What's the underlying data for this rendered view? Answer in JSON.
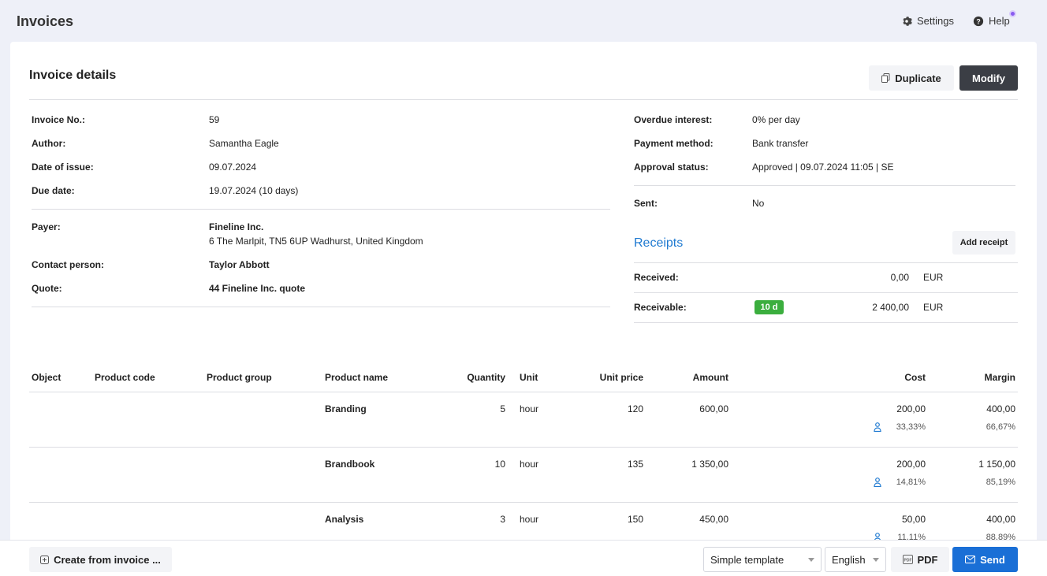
{
  "header": {
    "title": "Invoices",
    "settings_label": "Settings",
    "help_label": "Help"
  },
  "card": {
    "title": "Invoice details",
    "duplicate_label": "Duplicate",
    "modify_label": "Modify"
  },
  "details_left": {
    "invoice_no_label": "Invoice No.:",
    "invoice_no": "59",
    "author_label": "Author:",
    "author": "Samantha Eagle",
    "date_issue_label": "Date of issue:",
    "date_issue": "09.07.2024",
    "due_date_label": "Due date:",
    "due_date": "19.07.2024 (10 days)",
    "payer_label": "Payer:",
    "payer_name": "Fineline Inc.",
    "payer_address": "6 The Marlpit, TN5 6UP Wadhurst, United Kingdom",
    "contact_label": "Contact person:",
    "contact": "Taylor Abbott",
    "quote_label": "Quote:",
    "quote": "44 Fineline Inc. quote"
  },
  "details_right": {
    "overdue_label": "Overdue interest:",
    "overdue": "0% per day",
    "payment_label": "Payment method:",
    "payment": "Bank transfer",
    "approval_label": "Approval status:",
    "approval": "Approved | 09.07.2024 11:05 | SE",
    "sent_label": "Sent:",
    "sent": "No"
  },
  "receipts": {
    "title": "Receipts",
    "add_label": "Add receipt",
    "received_label": "Received:",
    "received_amount": "0,00",
    "received_currency": "EUR",
    "receivable_label": "Receivable:",
    "receivable_badge": "10 d",
    "receivable_amount": "2 400,00",
    "receivable_currency": "EUR"
  },
  "table": {
    "headers": {
      "object": "Object",
      "product_code": "Product code",
      "product_group": "Product group",
      "product_name": "Product name",
      "quantity": "Quantity",
      "unit": "Unit",
      "unit_price": "Unit price",
      "amount": "Amount",
      "cost": "Cost",
      "margin": "Margin"
    },
    "rows": [
      {
        "name": "Branding",
        "quantity": "5",
        "unit": "hour",
        "unit_price": "120",
        "amount": "600,00",
        "cost": "200,00",
        "cost_pct": "33,33%",
        "margin": "400,00",
        "margin_pct": "66,67%"
      },
      {
        "name": "Brandbook",
        "quantity": "10",
        "unit": "hour",
        "unit_price": "135",
        "amount": "1 350,00",
        "cost": "200,00",
        "cost_pct": "14,81%",
        "margin": "1 150,00",
        "margin_pct": "85,19%"
      },
      {
        "name": "Analysis",
        "quantity": "3",
        "unit": "hour",
        "unit_price": "150",
        "amount": "450,00",
        "cost": "50,00",
        "cost_pct": "11,11%",
        "margin": "400,00",
        "margin_pct": "88,89%"
      }
    ]
  },
  "footer": {
    "create_label": "Create from invoice ...",
    "template_value": "Simple template",
    "language_value": "English",
    "pdf_label": "PDF",
    "send_label": "Send"
  }
}
